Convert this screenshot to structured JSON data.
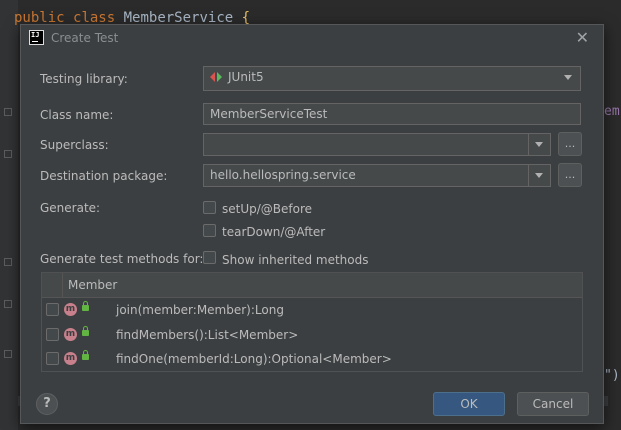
{
  "editor": {
    "code_keyword_public": "public",
    "code_keyword_class": "class",
    "code_class_name": "MemberService",
    "code_brace": "{",
    "right_text_1": "em",
    "right_text_2": "\")"
  },
  "dialog": {
    "title": "Create Test",
    "testing_library": {
      "label": "Testing library:",
      "value": "JUnit5"
    },
    "class_name": {
      "label": "Class name:",
      "value": "MemberServiceTest"
    },
    "superclass": {
      "label": "Superclass:",
      "value": "",
      "browse": "..."
    },
    "destination_package": {
      "label": "Destination package:",
      "value": "hello.hellospring.service",
      "browse": "..."
    },
    "generate": {
      "label": "Generate:",
      "options": [
        {
          "label": "setUp/@Before",
          "checked": false
        },
        {
          "label": "tearDown/@After",
          "checked": false
        }
      ]
    },
    "generate_methods": {
      "label": "Generate test methods for:",
      "show_inherited": {
        "label": "Show inherited methods",
        "checked": false
      }
    },
    "members": {
      "header": "Member",
      "icon_letter": "m",
      "rows": [
        {
          "signature": "join(member:Member):Long",
          "checked": false
        },
        {
          "signature": "findMembers():List<Member>",
          "checked": false
        },
        {
          "signature": "findOne(memberId:Long):Optional<Member>",
          "checked": false
        }
      ]
    },
    "footer": {
      "help": "?",
      "ok": "OK",
      "cancel": "Cancel"
    }
  }
}
